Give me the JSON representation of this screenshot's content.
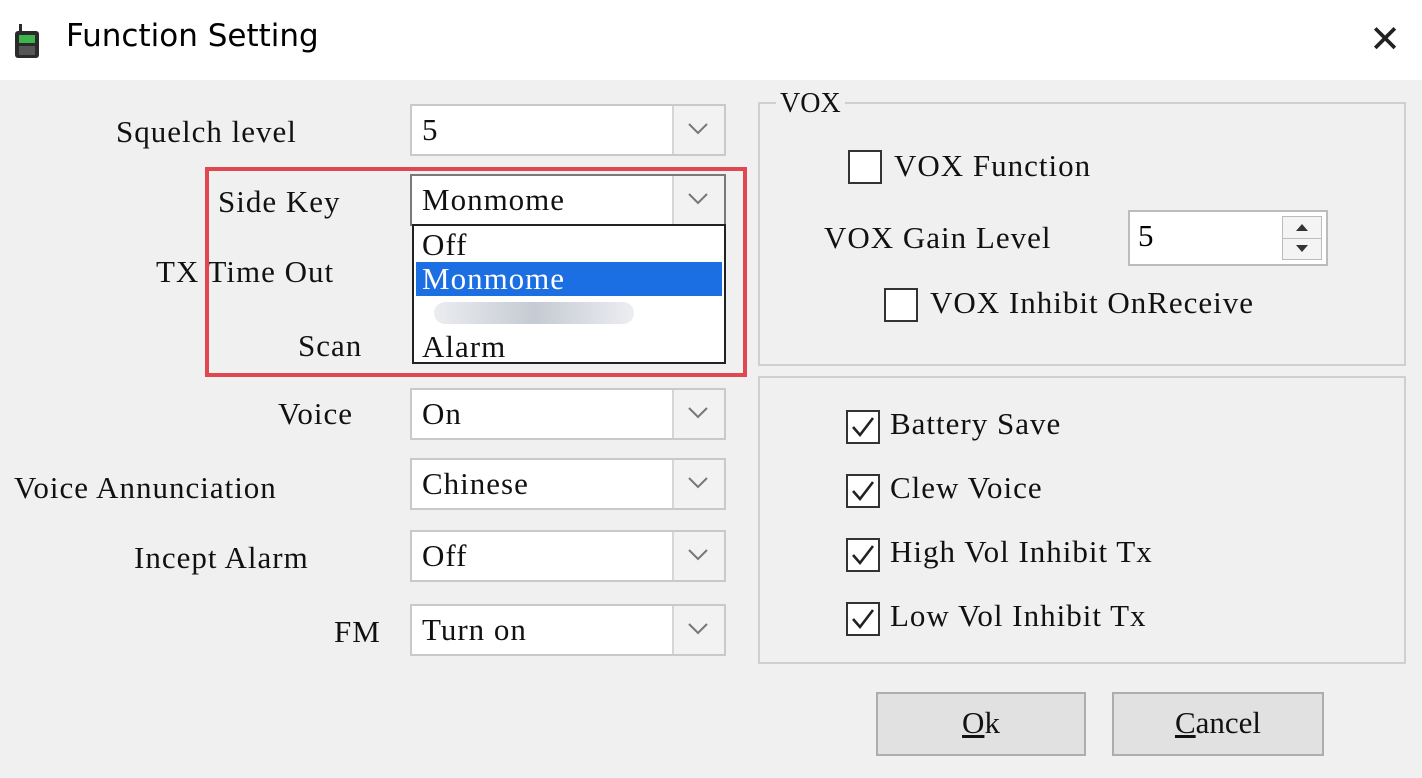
{
  "window": {
    "title": "Function Setting",
    "close_glyph": "✕"
  },
  "left": {
    "squelch": {
      "label": "Squelch level",
      "value": "5"
    },
    "side_key": {
      "label": "Side Key",
      "value": "Monmome",
      "options": [
        "Off",
        "Monmome",
        "Alarm"
      ],
      "selected_index": 1
    },
    "tx_time_out": {
      "label": "TX Time Out"
    },
    "scan": {
      "label": "Scan"
    },
    "voice": {
      "label": "Voice",
      "value": "On"
    },
    "voice_annunciation": {
      "label": "Voice Annunciation",
      "value": "Chinese"
    },
    "incept_alarm": {
      "label": "Incept Alarm",
      "value": "Off"
    },
    "fm": {
      "label": "FM",
      "value": "Turn on"
    }
  },
  "vox": {
    "caption": "VOX",
    "function": {
      "label": "VOX Function",
      "checked": false
    },
    "gain": {
      "label": "VOX Gain Level",
      "value": "5"
    },
    "inhibit": {
      "label": "VOX Inhibit OnReceive",
      "checked": false
    }
  },
  "options": [
    {
      "label": "Battery Save",
      "checked": true
    },
    {
      "label": "Clew Voice",
      "checked": true
    },
    {
      "label": "High Vol Inhibit Tx",
      "checked": true
    },
    {
      "label": "Low Vol Inhibit Tx",
      "checked": true
    }
  ],
  "buttons": {
    "ok": {
      "mnemonic": "O",
      "rest": "k"
    },
    "cancel": {
      "mnemonic": "C",
      "rest": "ancel"
    }
  },
  "colors": {
    "highlight": "#e0474f",
    "selection": "#1c6ee3"
  }
}
